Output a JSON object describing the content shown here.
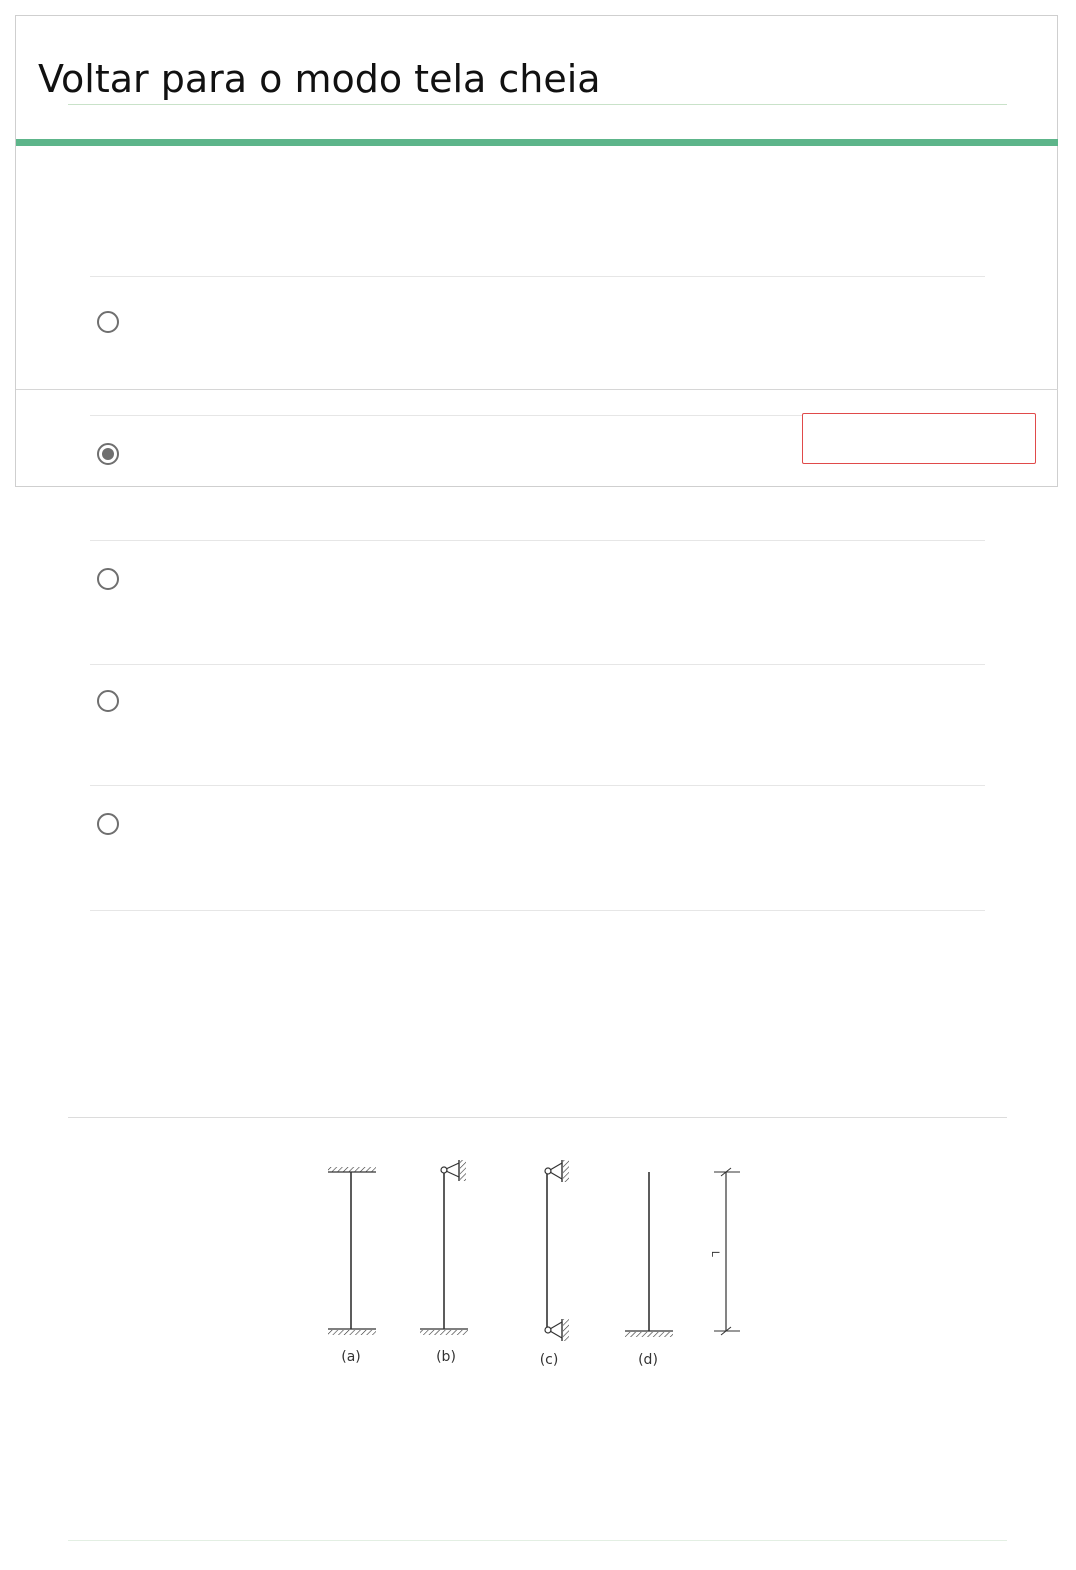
{
  "header": {
    "title": "Voltar para o modo tela cheia"
  },
  "question": {
    "options": [
      {
        "selected": false
      },
      {
        "selected": true
      },
      {
        "selected": false
      },
      {
        "selected": false
      },
      {
        "selected": false
      }
    ]
  },
  "figure": {
    "labels": [
      "(a)",
      "(b)",
      "(c)",
      "(d)"
    ],
    "length_label": "L"
  },
  "colors": {
    "accent_bar": "#5db58a",
    "error_border": "#e04a4a",
    "radio": "#6f6f6f"
  }
}
